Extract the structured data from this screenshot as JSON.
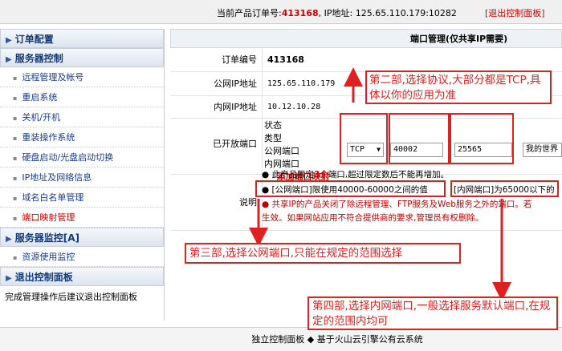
{
  "header": {
    "order_label": "当前产品订单号:",
    "order_no": "413168",
    "ip_label": ", IP地址:",
    "ip": "125.65.110.179:10282",
    "logout": "[退出控制面板]"
  },
  "sidebar": {
    "sections": [
      {
        "title": "订单配置"
      },
      {
        "title": "服务器控制"
      },
      {
        "title": "服务器监控[A]"
      },
      {
        "title": "退出控制面板"
      }
    ],
    "control_items": [
      "远程管理及帐号",
      "重启系统",
      "关机/开机",
      "重装操作系统",
      "硬盘启动/光盘启动切换",
      "IP地址及网络信息",
      "域名白名单管理",
      "端口映射管理"
    ],
    "monitor_items": [
      "资源使用监控"
    ],
    "footer": "完成管理操作后建议退出控制面板"
  },
  "main": {
    "title": "端口管理(仅共享IP需要)",
    "order_label": "订单编号",
    "order_value": "413168",
    "public_ip_label": "公网IP地址",
    "public_ip": "125.65.110.179",
    "private_ip_label": "内网IP地址",
    "private_ip": "10.12.10.28",
    "ports_label": "已开放端口",
    "columns": {
      "status": "状态",
      "type": "类型",
      "public_port": "公网端口",
      "private_port": "内网端口"
    },
    "add_mapping": "添加端口映射",
    "protocol": "TCP",
    "public_port_value": "40002",
    "private_port_value": "25565",
    "extra_select": "我的世界",
    "notes_label": "说明",
    "note1_a": "● 此产品限定",
    "note1_b": "3个",
    "note1_c": "端口,超过限定数后不能再增加。",
    "note2a": "● [公网端口]限使用40000-60000之间的值",
    "note2b": "[内网端口]为65000以下的",
    "note3": "● 共享IP的产品关闭了除远程管理、FTP服务及Web服务之外的端口。若",
    "note4": "生效。如果网站应用不符合提供商的要求,管理员有权删除。"
  },
  "status_bar": "独立控制面板 ◆ 基于火山云引擎公有云系统",
  "annotations": {
    "a2": "第二部,选择协议,大部分都是TCP,具体以你的应用为准",
    "a3": "第三部,选择公网端口,只能在规定的范围选择",
    "a4": "第四部,选择内网端口,一般选择服务默认端口,在规定的范围内均可"
  },
  "colors": {
    "accent_red": "#e02020",
    "order_red": "#d00000",
    "link_blue": "#1a3c8a"
  }
}
